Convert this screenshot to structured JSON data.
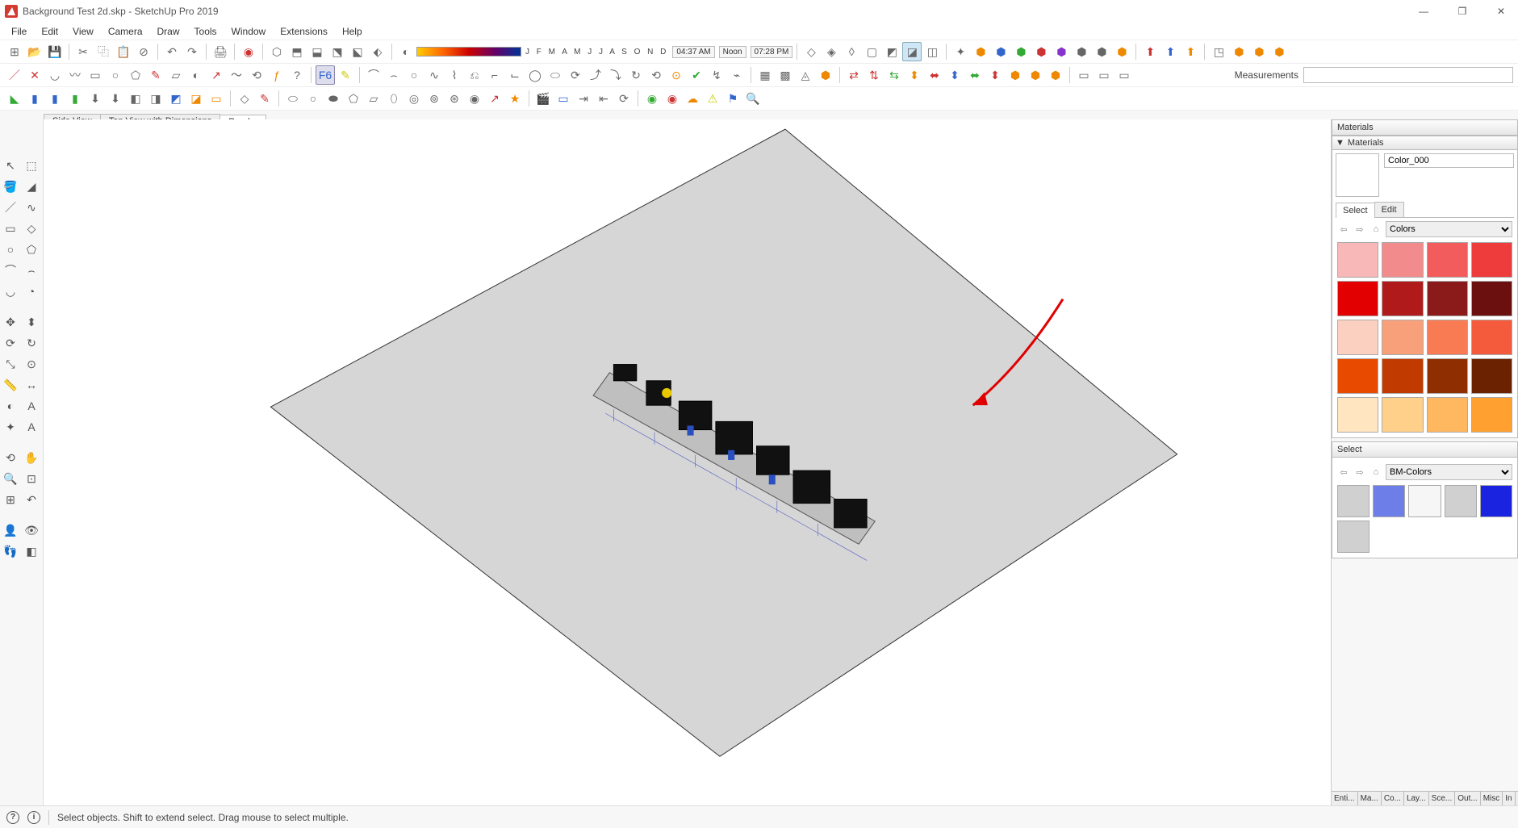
{
  "window": {
    "title": "Background Test 2d.skp - SketchUp Pro 2019"
  },
  "menu": [
    "File",
    "Edit",
    "View",
    "Camera",
    "Draw",
    "Tools",
    "Window",
    "Extensions",
    "Help"
  ],
  "times": {
    "t1": "04:37 AM",
    "noon": "Noon",
    "t2": "07:28 PM"
  },
  "months": "J F M A M J J A S O N D",
  "measurements_label": "Measurements",
  "scene_tabs": [
    "Side View",
    "Top View with Dimensions",
    "Render"
  ],
  "active_scene": 2,
  "materials": {
    "panel_title": "Materials",
    "section_title": "Materials",
    "current_name": "Color_000",
    "tab_select": "Select",
    "tab_edit": "Edit",
    "dropdown1": "Colors",
    "swatches1": [
      "#f8b8b8",
      "#f28b8b",
      "#f25c5c",
      "#ee3b3b",
      "#e20000",
      "#b01a1a",
      "#8b1a1a",
      "#6b0f0f",
      "#fcd0c0",
      "#f8a07a",
      "#f97b53",
      "#f45a3c",
      "#e84a00",
      "#c13a00",
      "#8f2e00",
      "#6b2200",
      "#ffe6c0",
      "#ffd08a",
      "#ffb860",
      "#ffa030"
    ],
    "select2_title": "Select",
    "dropdown2": "BM-Colors",
    "swatches2": [
      "#d0d0d0",
      "#6e7ee8",
      "#f6f6f6",
      "#d0d0d0",
      "#1a24e0",
      "#d0d0d0"
    ]
  },
  "bottom_tabs": [
    "Enti...",
    "Ma...",
    "Co...",
    "Lay...",
    "Sce...",
    "Out...",
    "Misc",
    "In"
  ],
  "status": {
    "text": "Select objects. Shift to extend select. Drag mouse to select multiple."
  }
}
